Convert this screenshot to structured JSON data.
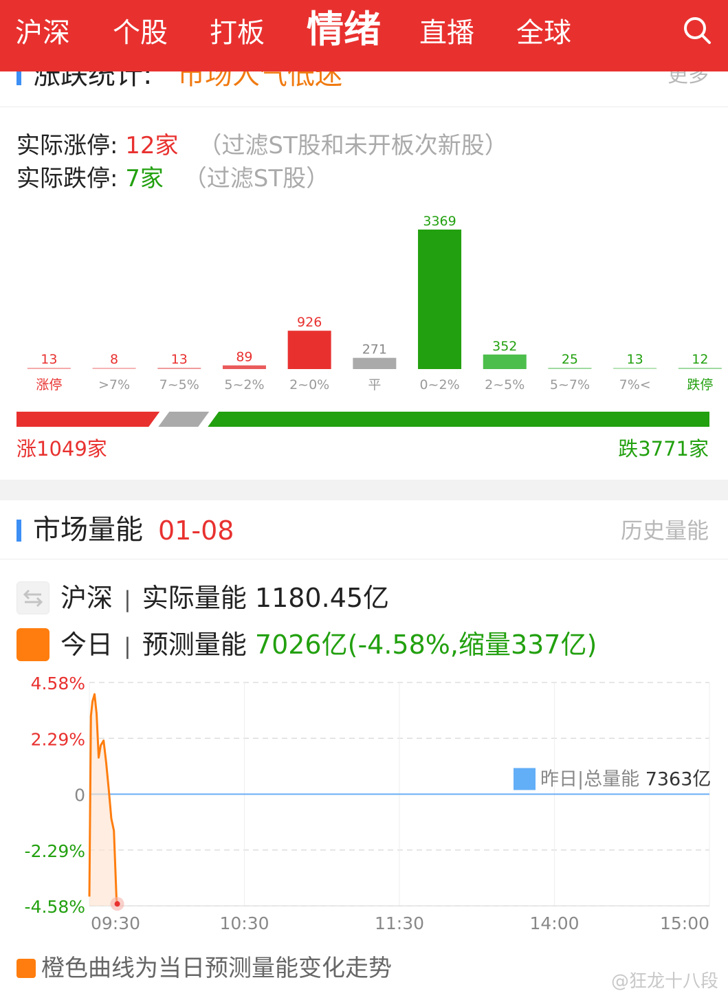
{
  "nav": {
    "tabs": [
      {
        "label": "沪深"
      },
      {
        "label": "个股"
      },
      {
        "label": "打板"
      },
      {
        "label": "情绪",
        "active": true
      },
      {
        "label": "直播"
      },
      {
        "label": "全球"
      }
    ],
    "search_icon": "search-icon",
    "bg_color": "#e8312f"
  },
  "section1": {
    "title": "涨跌统计:",
    "mood": "市场人气低迷",
    "more": "更多",
    "limit_up": {
      "key": "实际涨停:",
      "value": "12家",
      "note": "（过滤ST股和未开板次新股）"
    },
    "limit_down": {
      "key": "实际跌停:",
      "value": "7家",
      "note": "（过滤ST股）"
    },
    "rise_total": "涨1049家",
    "fall_total": "跌3771家",
    "ratio": {
      "up": 1049,
      "flat": 271,
      "down": 3771
    }
  },
  "chart_data": [
    {
      "type": "bar",
      "categories": [
        "涨停",
        ">7%",
        "7~5%",
        "5~2%",
        "2~0%",
        "平",
        "0~2%",
        "2~5%",
        "5~7%",
        "7%<",
        "跌停"
      ],
      "values": [
        13,
        8,
        13,
        89,
        926,
        271,
        3369,
        352,
        25,
        13,
        12
      ],
      "value_labels": [
        "13",
        "8",
        "13",
        "89",
        "926",
        "271",
        "3369",
        "352",
        "25",
        "13",
        "12"
      ],
      "bar_colors": [
        "#f5a9a9",
        "#f5b4b4",
        "#f09a9a",
        "#ea5a5a",
        "#e8312f",
        "#aaaaaa",
        "#22a00f",
        "#4cbe4c",
        "#9fd99f",
        "#b6e3b6",
        "#9fd99f"
      ],
      "label_colors": [
        "#e8312f",
        "#e8312f",
        "#e8312f",
        "#e8312f",
        "#e8312f",
        "#888888",
        "#22a00f",
        "#22a00f",
        "#22a00f",
        "#22a00f",
        "#22a00f"
      ],
      "category_colors": [
        "#e8312f",
        "#999999",
        "#999999",
        "#999999",
        "#999999",
        "#999999",
        "#999999",
        "#999999",
        "#999999",
        "#999999",
        "#22a00f"
      ],
      "title": "",
      "xlabel": "",
      "ylabel": ""
    },
    {
      "type": "line",
      "title": "",
      "xlabel": "",
      "ylabel": "",
      "y_ticks": [
        "4.58%",
        "2.29%",
        "0",
        "-2.29%",
        "-4.58%"
      ],
      "y_tick_colors": [
        "#e8312f",
        "#e8312f",
        "#888888",
        "#22a00f",
        "#22a00f"
      ],
      "ylim": [
        -4.58,
        4.58
      ],
      "x_ticks": [
        "09:30",
        "10:30",
        "11:30",
        "14:00",
        "15:00"
      ],
      "x_tick_minutes": [
        0,
        60,
        120,
        180,
        240
      ],
      "x_range_minutes": [
        0,
        240
      ],
      "series": [
        {
          "color": "#ff7d0e",
          "x_minutes": [
            0,
            0.6,
            1.2,
            2,
            2.8,
            3.6,
            4.4,
            5.5,
            6.5,
            7.5,
            8.5,
            9.5,
            10.5,
            10.8
          ],
          "values": [
            -4.2,
            3.2,
            3.8,
            4.1,
            3.3,
            1.5,
            2.0,
            2.2,
            1.3,
            0.2,
            -1.0,
            -1.5,
            -4.3,
            -4.5
          ]
        }
      ],
      "reference_line": {
        "value": 0,
        "color": "#6aaef5"
      },
      "grid": true,
      "legend": {
        "label": "昨日|总量能",
        "value": "7363亿",
        "color": "#62aef7",
        "position": "right"
      }
    }
  ],
  "section2": {
    "title": "市场量能",
    "date": "01-08",
    "history": "历史量能",
    "actual": {
      "icon": "exchange-icon",
      "name": "沪深",
      "sep": "|",
      "label": "实际量能",
      "value": "1180.45亿"
    },
    "forecast": {
      "icon": "orange-square-icon",
      "name": "今日",
      "sep": "|",
      "label": "预测量能",
      "value": "7026亿(-4.58%,缩量337亿)"
    },
    "footer_note": "橙色曲线为当日预测量能变化走势"
  },
  "watermark": "@狂龙十八段"
}
